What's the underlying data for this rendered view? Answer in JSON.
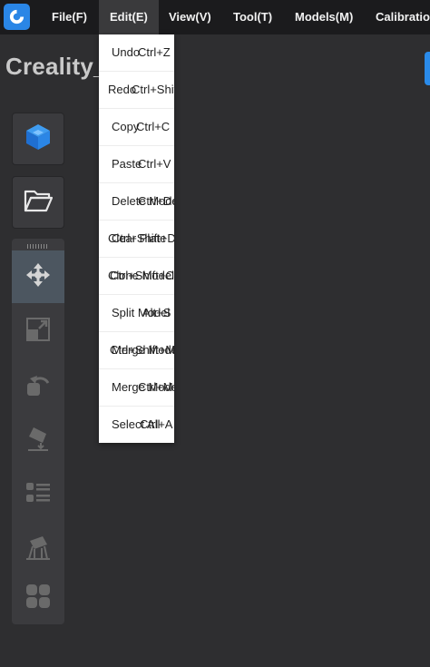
{
  "app": {
    "title": "Creality_",
    "logo_icon": "creality-logo-icon",
    "accent": "#2a86e6"
  },
  "menubar": {
    "items": [
      {
        "label": "File(F)"
      },
      {
        "label": "Edit(E)"
      },
      {
        "label": "View(V)"
      },
      {
        "label": "Tool(T)"
      },
      {
        "label": "Models(M)"
      },
      {
        "label": "Calibration"
      }
    ],
    "active": "Edit(E)"
  },
  "edit_menu": {
    "items": [
      {
        "label": "Undo",
        "shortcut": "Ctrl+Z"
      },
      {
        "label": "Redo",
        "shortcut": "Ctrl+Shift+Z"
      },
      {
        "label": "Copy",
        "shortcut": "Ctrl+C"
      },
      {
        "label": "Paste",
        "shortcut": "Ctrl+V"
      },
      {
        "label": "Delete Model",
        "shortcut": "Ctrl+Del"
      },
      {
        "label": "Clear Plate",
        "shortcut": "Ctrl+Shift+D"
      },
      {
        "label": "Clone Model",
        "shortcut": "Ctrl+Shift+C"
      },
      {
        "label": "Split Model",
        "shortcut": "Alt+S"
      },
      {
        "label": "Merge Model",
        "shortcut": "Ctrl+Shift+M"
      },
      {
        "label": "Merge Model",
        "shortcut": "Ctrl+M"
      },
      {
        "label": "Select All",
        "shortcut": "Ctrl+A"
      }
    ]
  },
  "left_toolbar": {
    "buttons": [
      {
        "icon": "cube-icon"
      },
      {
        "icon": "open-folder-icon"
      }
    ],
    "tools": [
      {
        "icon": "move-icon",
        "active": true
      },
      {
        "icon": "scale-icon"
      },
      {
        "icon": "rotate-icon"
      },
      {
        "icon": "lay-flat-icon"
      },
      {
        "icon": "list-icon"
      },
      {
        "icon": "support-icon"
      },
      {
        "icon": "arrange-icon"
      }
    ]
  }
}
